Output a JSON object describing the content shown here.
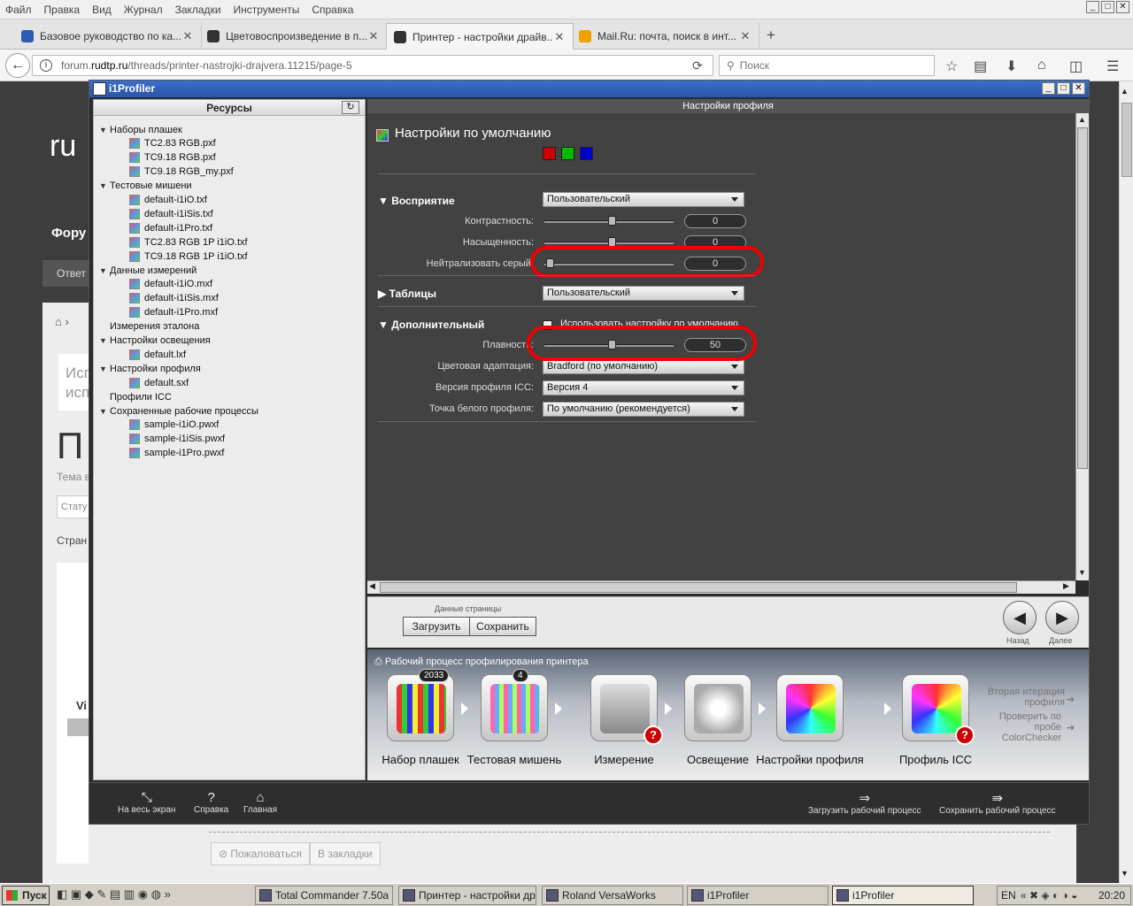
{
  "browser": {
    "menu": [
      "Файл",
      "Правка",
      "Вид",
      "Журнал",
      "Закладки",
      "Инструменты",
      "Справка"
    ],
    "tabs": [
      {
        "label": "Базовое руководство по ка...",
        "color": "#2a5db0"
      },
      {
        "label": "Цветовоспроизведение в п...",
        "color": "#333"
      },
      {
        "label": "Принтер - настройки драйв...",
        "color": "#333",
        "active": true
      },
      {
        "label": "Mail.Ru: почта, поиск в инт...",
        "color": "#f0a000"
      }
    ],
    "url_pre": "forum.",
    "url_host": "rudtp.ru",
    "url_path": "/threads/printer-nastrojki-drajvera.11215/page-5",
    "search_placeholder": "Поиск"
  },
  "bgpage": {
    "logo": "ru",
    "forum": "Фору",
    "reply": "Ответ",
    "t1": "Исп",
    "t2": "испо",
    "big": "П",
    "topic": "Тема в",
    "status": "Стату",
    "pages": "Стран",
    "vi": "Vi",
    "report": "Пожаловаться",
    "bookmark": "В закладки"
  },
  "app": {
    "title": "i1Profiler",
    "resources": "Ресурсы",
    "profile_settings": "Настройки профиля",
    "tree": [
      {
        "t": "Наборы плашек",
        "lvl": 0
      },
      {
        "t": "TC2.83 RGB.pxf",
        "lvl": 1
      },
      {
        "t": "TC9.18 RGB.pxf",
        "lvl": 1
      },
      {
        "t": "TC9.18 RGB_my.pxf",
        "lvl": 1
      },
      {
        "t": "Тестовые мишени",
        "lvl": 0
      },
      {
        "t": "default-i1iO.txf",
        "lvl": 1
      },
      {
        "t": "default-i1iSis.txf",
        "lvl": 1
      },
      {
        "t": "default-i1Pro.txf",
        "lvl": 1
      },
      {
        "t": "TC2.83 RGB 1P i1iO.txf",
        "lvl": 1
      },
      {
        "t": "TC9.18 RGB 1P i1iO.txf",
        "lvl": 1
      },
      {
        "t": "Данные измерений",
        "lvl": 0
      },
      {
        "t": "default-i1iO.mxf",
        "lvl": 1
      },
      {
        "t": "default-i1iSis.mxf",
        "lvl": 1
      },
      {
        "t": "default-i1Pro.mxf",
        "lvl": 1
      },
      {
        "t": "Измерения эталона",
        "lvl": 0,
        "leaf": true
      },
      {
        "t": "Настройки освещения",
        "lvl": 0
      },
      {
        "t": "default.lxf",
        "lvl": 1
      },
      {
        "t": "Настройки профиля",
        "lvl": 0
      },
      {
        "t": "default.sxf",
        "lvl": 1
      },
      {
        "t": "Профили ICC",
        "lvl": 0,
        "leaf": true
      },
      {
        "t": "Сохраненные рабочие процессы",
        "lvl": 0
      },
      {
        "t": "sample-i1iO.pwxf",
        "lvl": 1
      },
      {
        "t": "sample-i1iSis.pwxf",
        "lvl": 1
      },
      {
        "t": "sample-i1Pro.pwxf",
        "lvl": 1
      }
    ],
    "default_title": "Настройки по умолчанию",
    "perception": "Восприятие",
    "perception_value": "Пользовательский",
    "contrast": "Контрастность:",
    "contrast_value": "0",
    "contrast_level": 0.5,
    "saturation": "Насыщенность:",
    "saturation_value": "0",
    "saturation_level": 0.5,
    "neutralize": "Нейтрализовать серый:",
    "neutralize_value": "0",
    "neutralize_level": 0.0,
    "tables": "Таблицы",
    "tables_value": "Пользовательский",
    "advanced": "Дополнительный",
    "use_default": "Использовать настройку по умолчанию",
    "smoothness": "Плавность:",
    "smoothness_value": "50",
    "smoothness_level": 0.5,
    "chromatic": "Цветовая адаптация:",
    "chromatic_value": "Bradford (по умолчанию)",
    "icc_version": "Версия профиля ICC:",
    "icc_version_value": "Версия 4",
    "white_point": "Точка белого профиля:",
    "white_point_value": "По умолчанию (рекомендуется)",
    "page_data": "Данные страницы",
    "load": "Загрузить",
    "save": "Сохранить",
    "back": "Назад",
    "next": "Далее",
    "workflow_title": "Рабочий процесс профилирования принтера",
    "steps": [
      {
        "label": "Набор плашек",
        "badge": "2033"
      },
      {
        "label": "Тестовая мишень",
        "badge": "4"
      },
      {
        "label": "Измерение",
        "q": true
      },
      {
        "label": "Освещение"
      },
      {
        "label": "Настройки профиля"
      },
      {
        "label": "Профиль ICC",
        "q": true
      }
    ],
    "second_iter": "Вторая итерация профиля",
    "check_probe": "Проверить по пробе ColorChecker",
    "fullscreen": "На весь экран",
    "help": "Справка",
    "home": "Главная",
    "load_wf": "Загрузить рабочий процесс",
    "save_wf": "Сохранить рабочий процесс"
  },
  "taskbar": {
    "start": "Пуск",
    "items": [
      {
        "label": "Total Commander 7.50a ..."
      },
      {
        "label": "Принтер - настройки др..."
      },
      {
        "label": "Roland VersaWorks"
      },
      {
        "label": "i1Profiler"
      },
      {
        "label": "i1Profiler",
        "active": true
      }
    ],
    "lang": "EN",
    "time": "20:20"
  }
}
